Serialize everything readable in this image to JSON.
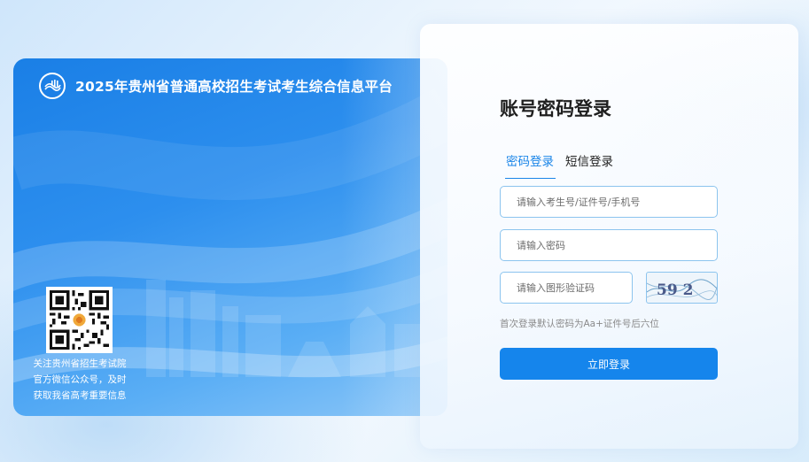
{
  "brand": {
    "title": "2025年贵州省普通高校招生考试考生综合信息平台",
    "logo_icon": "exam-institute-logo-icon"
  },
  "qr": {
    "caption_lines": [
      "关注贵州省招生考试院",
      "官方微信公众号，及时",
      "获取我省高考重要信息"
    ]
  },
  "login": {
    "title": "账号密码登录",
    "tabs": [
      {
        "label": "密码登录",
        "active": true
      },
      {
        "label": "短信登录",
        "active": false
      }
    ],
    "account_placeholder": "请输入考生号/证件号/手机号",
    "password_placeholder": "请输入密码",
    "captcha_placeholder": "请输入图形验证码",
    "captcha_text": "59 2",
    "hint": "首次登录默认密码为Aa+证件号后六位",
    "submit_label": "立即登录"
  },
  "colors": {
    "accent": "#1585ec",
    "tab_active": "#1a85e8",
    "input_border": "#8cc4ee",
    "card_blue": "#1a7fe6"
  }
}
